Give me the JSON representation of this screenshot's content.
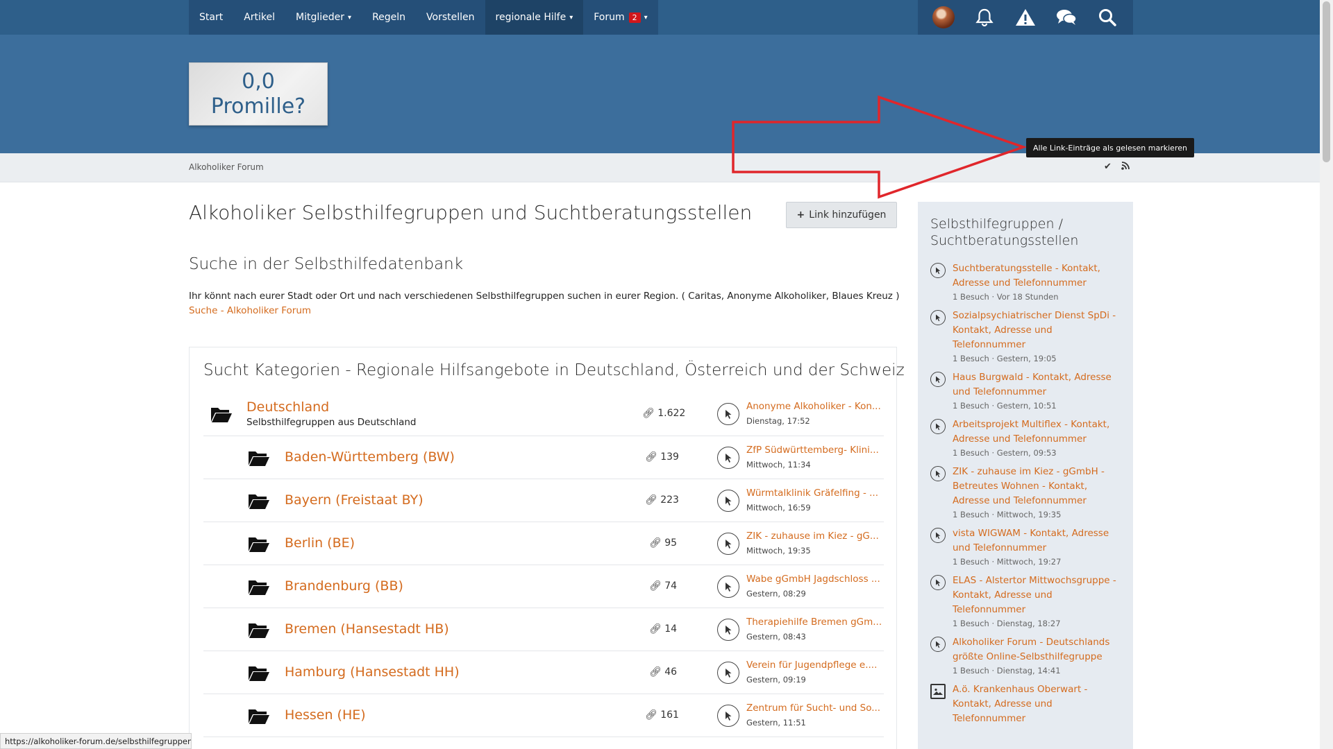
{
  "nav": {
    "items": [
      {
        "label": "Start"
      },
      {
        "label": "Artikel"
      },
      {
        "label": "Mitglieder"
      },
      {
        "label": "Regeln"
      },
      {
        "label": "Vorstellen"
      },
      {
        "label": "regionale Hilfe"
      },
      {
        "label": "Forum",
        "badge": "2"
      }
    ],
    "icons": [
      "avatar",
      "bell-icon",
      "warning-icon",
      "chat-icon",
      "search-icon"
    ]
  },
  "logo": {
    "line1": "0,0",
    "line2": "Promille?"
  },
  "breadcrumb": {
    "label": "Alkoholiker Forum"
  },
  "tooltip": "Alle Link-Einträge als gelesen markieren",
  "page": {
    "title": "Alkoholiker Selbsthilfegruppen und Suchtberatungsstellen",
    "add_button": "Link hinzufügen",
    "search_section": {
      "title": "Suche in der Selbsthilfedatenbank",
      "text": "Ihr könnt nach eurer Stadt oder Ort und nach verschiedenen Selbsthilfegruppen suchen in eurer Region. ( Caritas, Anonyme Alkoholiker, Blaues Kreuz )",
      "link": "Suche - Alkoholiker Forum"
    }
  },
  "categories": {
    "heading": "Sucht Kategorien - Regionale Hilfsangebote in Deutschland, Österreich und der Schweiz",
    "main": {
      "title": "Deutschland",
      "sub": "Selbsthilfegruppen aus Deutschland",
      "count": "1.622",
      "last": "Anonyme Alkoholiker - Kon...",
      "date": "Dienstag, 17:52"
    },
    "rows": [
      {
        "title": "Baden-Württemberg (BW)",
        "count": "139",
        "last": "ZfP Südwürttemberg- Klini...",
        "date": "Mittwoch, 11:34"
      },
      {
        "title": "Bayern (Freistaat BY)",
        "count": "223",
        "last": "Würmtalklinik Gräfelfing - ...",
        "date": "Mittwoch, 16:59"
      },
      {
        "title": "Berlin (BE)",
        "count": "95",
        "last": "ZIK - zuhause im Kiez - gG...",
        "date": "Mittwoch, 19:35"
      },
      {
        "title": "Brandenburg (BB)",
        "count": "74",
        "last": "Wabe gGmbH Jagdschloss ...",
        "date": "Gestern, 08:29"
      },
      {
        "title": "Bremen (Hansestadt HB)",
        "count": "14",
        "last": "Therapiehilfe Bremen gGm...",
        "date": "Gestern, 08:43"
      },
      {
        "title": "Hamburg (Hansestadt HH)",
        "count": "46",
        "last": "Verein für Jugendpflege e....",
        "date": "Gestern, 09:19"
      },
      {
        "title": "Hessen (HE)",
        "count": "161",
        "last": "Zentrum für Sucht- und So...",
        "date": "Gestern, 11:51"
      }
    ]
  },
  "sidebar": {
    "title": "Selbsthilfegruppen / Suchtberatungsstellen",
    "items": [
      {
        "link": "Suchtberatungsstelle - Kontakt, Adresse und Telefonnummer",
        "meta": "1 Besuch · Vor 18 Stunden"
      },
      {
        "link": "Sozialpsychiatrischer Dienst SpDi - Kontakt, Adresse und Telefonnummer",
        "meta": "1 Besuch · Gestern, 19:05"
      },
      {
        "link": "Haus Burgwald - Kontakt, Adresse und Telefonnummer",
        "meta": "1 Besuch · Gestern, 10:51"
      },
      {
        "link": "Arbeitsprojekt Multiflex - Kontakt, Adresse und Telefonnummer",
        "meta": "1 Besuch · Gestern, 09:53"
      },
      {
        "link": "ZIK - zuhause im Kiez - gGmbH - Betreutes Wohnen - Kontakt, Adresse und Telefonnummer",
        "meta": "1 Besuch · Mittwoch, 19:35"
      },
      {
        "link": "vista WIGWAM - Kontakt, Adresse und Telefonnummer",
        "meta": "1 Besuch · Mittwoch, 19:27"
      },
      {
        "link": "ELAS - Alstertor Mittwochsgruppe - Kontakt, Adresse und Telefonnummer",
        "meta": "1 Besuch · Dienstag, 18:27"
      },
      {
        "link": "Alkoholiker Forum - Deutschlands größte Online-Selbsthilfegruppe",
        "meta": "1 Besuch · Dienstag, 14:41"
      },
      {
        "link": "A.ö. Krankenhaus Oberwart - Kontakt, Adresse und Telefonnummer",
        "meta": ""
      }
    ]
  },
  "statusbar": "https://alkoholiker-forum.de/selbsthilfegruppen/#",
  "colors": {
    "nav": "#254f78",
    "header": "#3c6e9c",
    "link": "#d46b1e",
    "arrow": "#e0262b"
  }
}
